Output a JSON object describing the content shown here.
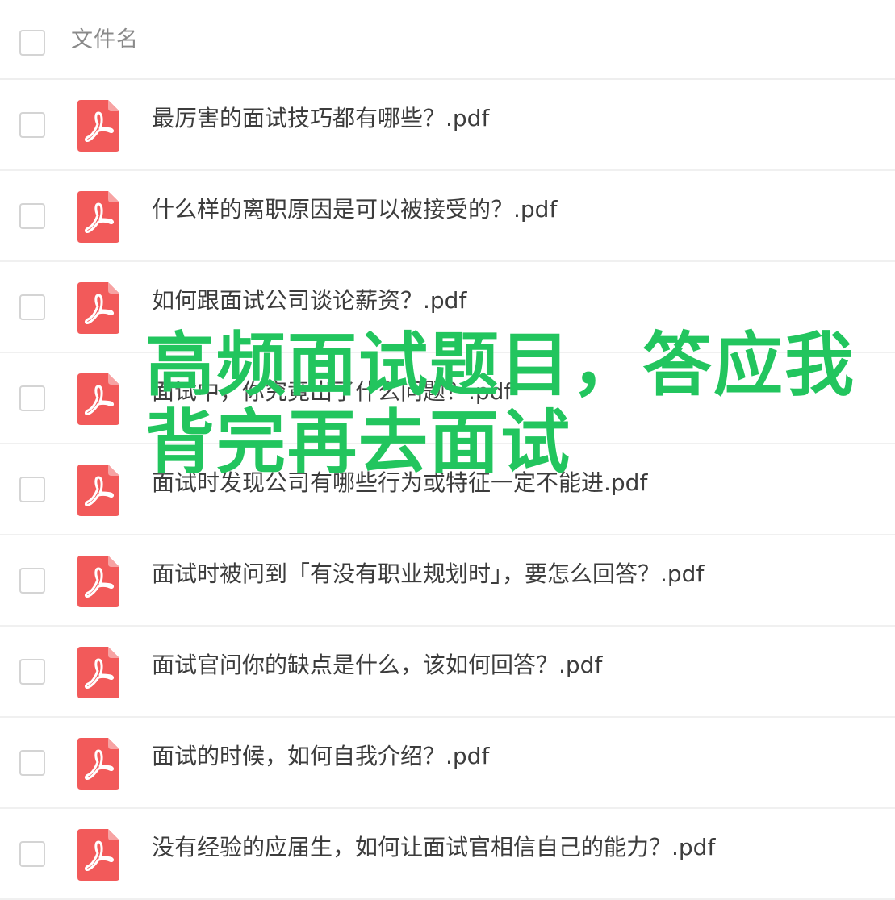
{
  "header": {
    "column_label": "文件名"
  },
  "files": [
    {
      "name": "最厉害的面试技巧都有哪些？.pdf",
      "icon": "pdf-icon"
    },
    {
      "name": "什么样的离职原因是可以被接受的？.pdf",
      "icon": "pdf-icon"
    },
    {
      "name": "如何跟面试公司谈论薪资？.pdf",
      "icon": "pdf-icon"
    },
    {
      "name": "面试中，你究竟出了什么问题？.pdf",
      "icon": "pdf-icon"
    },
    {
      "name": "面试时发现公司有哪些行为或特征一定不能进.pdf",
      "icon": "pdf-icon"
    },
    {
      "name": "面试时被问到「有没有职业规划时」，要怎么回答？.pdf",
      "icon": "pdf-icon"
    },
    {
      "name": "面试官问你的缺点是什么，该如何回答？.pdf",
      "icon": "pdf-icon"
    },
    {
      "name": "面试的时候，如何自我介绍？.pdf",
      "icon": "pdf-icon"
    },
    {
      "name": "没有经验的应届生，如何让面试官相信自己的能力？.pdf",
      "icon": "pdf-icon"
    }
  ],
  "overlay": {
    "line1": "高频面试题目，答应我",
    "line2": "背完再去面试"
  },
  "colors": {
    "pdf_icon": "#f25a5a",
    "overlay_text": "#22c55e",
    "file_text": "#3c3c3c",
    "header_text": "#8a8a8a",
    "checkbox_border": "#d4d4d4"
  }
}
